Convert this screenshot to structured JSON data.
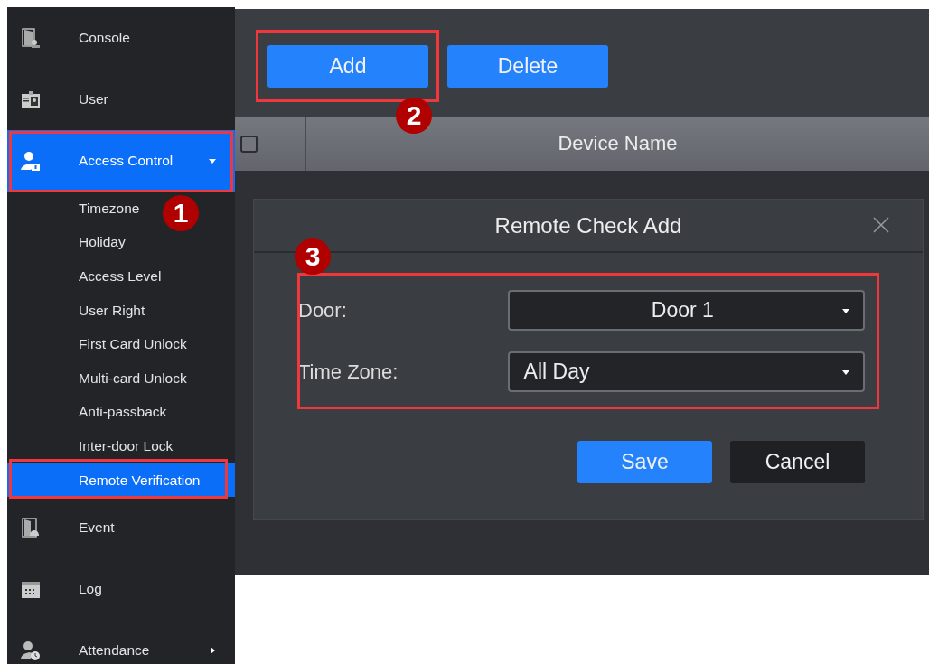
{
  "sidebar": {
    "items": [
      {
        "label": "Console",
        "selected": false
      },
      {
        "label": "User",
        "selected": false
      },
      {
        "label": "Access Control",
        "selected": true,
        "expanded": true,
        "children": [
          {
            "label": "Timezone",
            "selected": false
          },
          {
            "label": "Holiday",
            "selected": false
          },
          {
            "label": "Access Level",
            "selected": false
          },
          {
            "label": "User Right",
            "selected": false
          },
          {
            "label": "First Card Unlock",
            "selected": false
          },
          {
            "label": "Multi-card Unlock",
            "selected": false
          },
          {
            "label": "Anti-passback",
            "selected": false
          },
          {
            "label": "Inter-door Lock",
            "selected": false
          },
          {
            "label": "Remote Verification",
            "selected": true
          }
        ]
      },
      {
        "label": "Event",
        "selected": false
      },
      {
        "label": "Log",
        "selected": false
      },
      {
        "label": "Attendance",
        "selected": false,
        "expanded": false
      }
    ]
  },
  "toolbar": {
    "buttons": [
      "Add",
      "Delete"
    ]
  },
  "table": {
    "select_all_checked": false,
    "columns": [
      "Device Name"
    ]
  },
  "dialog": {
    "title": "Remote Check Add",
    "fields": [
      {
        "label": "Door:",
        "value": "Door 1"
      },
      {
        "label": "Time Zone:",
        "value": "All Day"
      }
    ],
    "buttons": [
      {
        "label": "Save",
        "kind": "primary"
      },
      {
        "label": "Cancel",
        "kind": "secondary"
      }
    ]
  },
  "annotations": [
    {
      "label": "1"
    },
    {
      "label": "2"
    },
    {
      "label": "3"
    }
  ]
}
